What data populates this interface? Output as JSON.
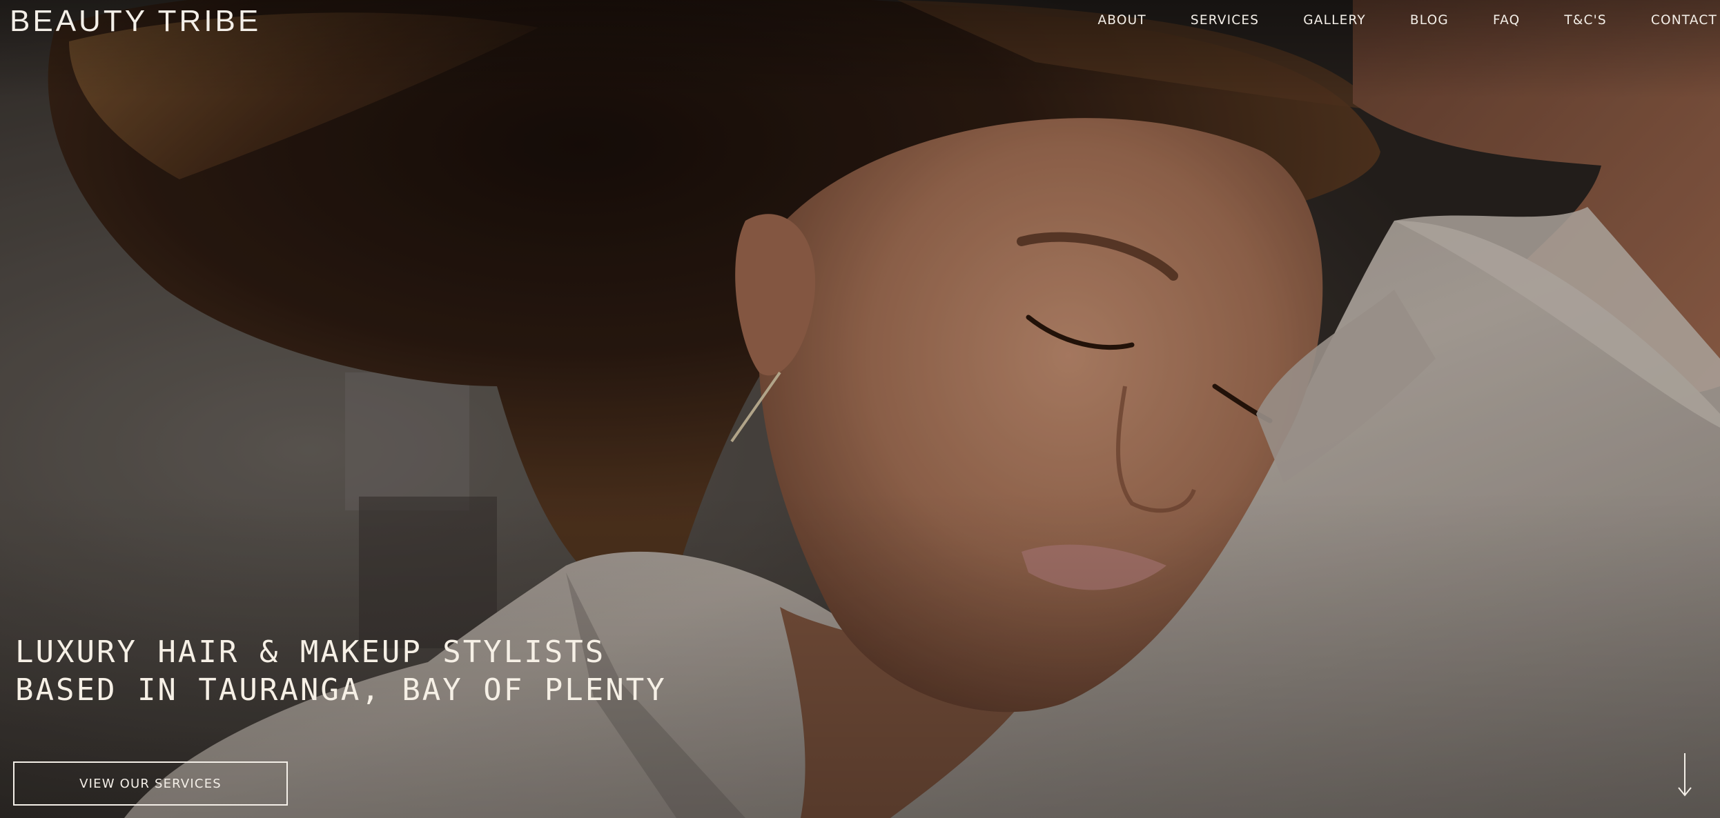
{
  "brand": {
    "logo_text": "BEAUTY TRIBE"
  },
  "nav": {
    "items": [
      {
        "label": "ABOUT"
      },
      {
        "label": "SERVICES"
      },
      {
        "label": "GALLERY"
      },
      {
        "label": "BLOG"
      },
      {
        "label": "FAQ"
      },
      {
        "label": "T&C'S"
      },
      {
        "label": "CONTACT"
      }
    ]
  },
  "hero": {
    "headline_line1": "LUXURY HAIR & MAKEUP STYLISTS",
    "headline_line2": "BASED IN TAURANGA, BAY OF PLENTY",
    "cta_label": "VIEW OUR SERVICES"
  },
  "colors": {
    "text": "#f4efe8",
    "overlay_dark": "#1a1410",
    "shirt": "#b7aca3",
    "skin": "#b07e62",
    "hair": "#3b2414"
  },
  "icons": {
    "scroll": "arrow-down-icon"
  }
}
